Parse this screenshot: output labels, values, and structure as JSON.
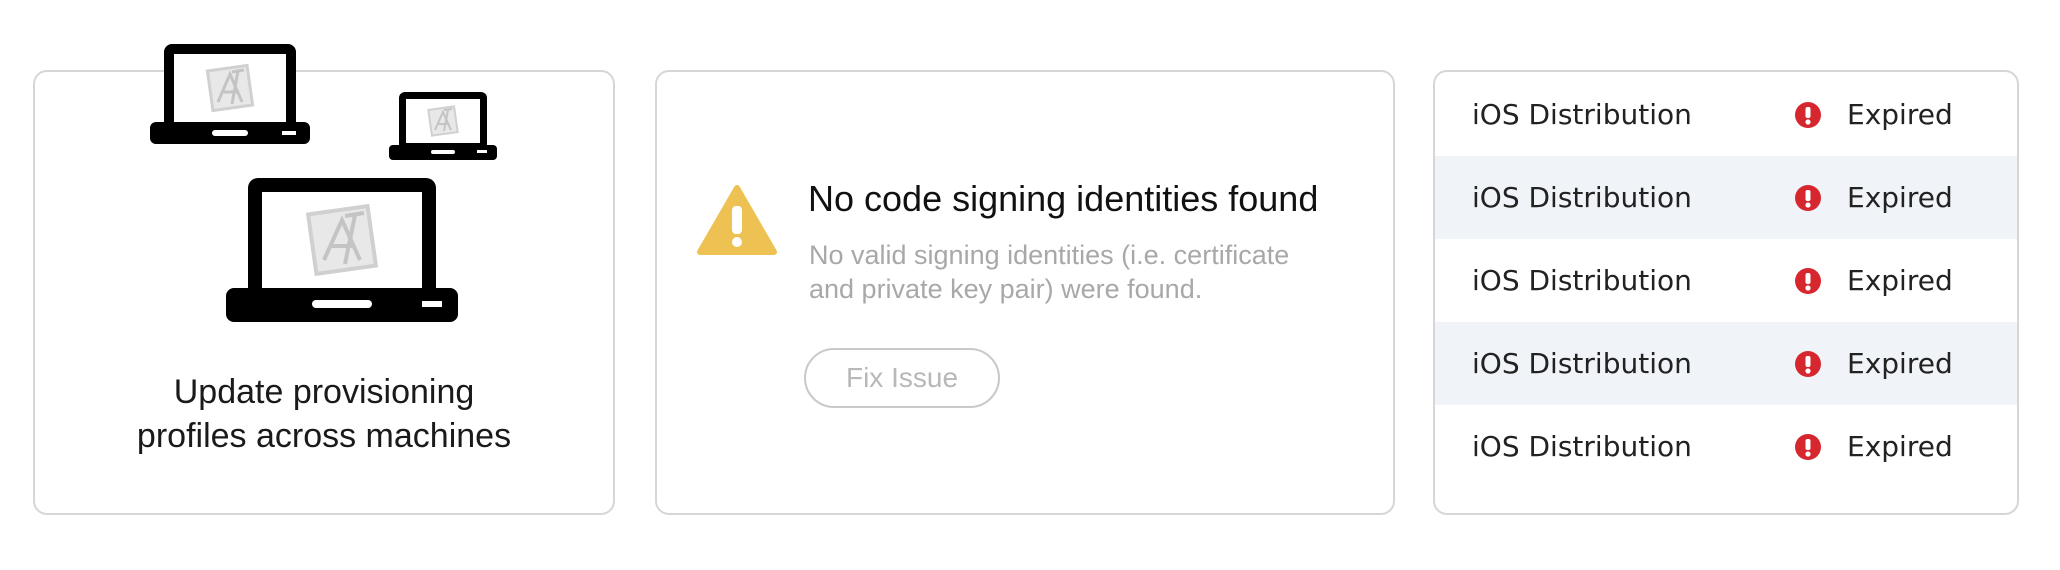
{
  "provisioning": {
    "caption_line1": "Update provisioning",
    "caption_line2": "profiles across machines",
    "icon": "laptop-icon"
  },
  "signing_message": {
    "icon": "warning-icon",
    "title": "No code signing identities found",
    "detail_line1": "No valid signing identities (i.e. certificate",
    "detail_line2": "and private key pair) were found.",
    "fix_button_label": "Fix Issue"
  },
  "certificates": [
    {
      "name": "iOS Distribution",
      "status": "Expired"
    },
    {
      "name": "iOS Distribution",
      "status": "Expired"
    },
    {
      "name": "iOS Distribution",
      "status": "Expired"
    },
    {
      "name": "iOS Distribution",
      "status": "Expired"
    },
    {
      "name": "iOS Distribution",
      "status": "Expired"
    }
  ],
  "colors": {
    "warning": "#edc252",
    "error": "#d6262e",
    "row_alt": "#f0f4f8",
    "border": "#d6d6d6"
  }
}
